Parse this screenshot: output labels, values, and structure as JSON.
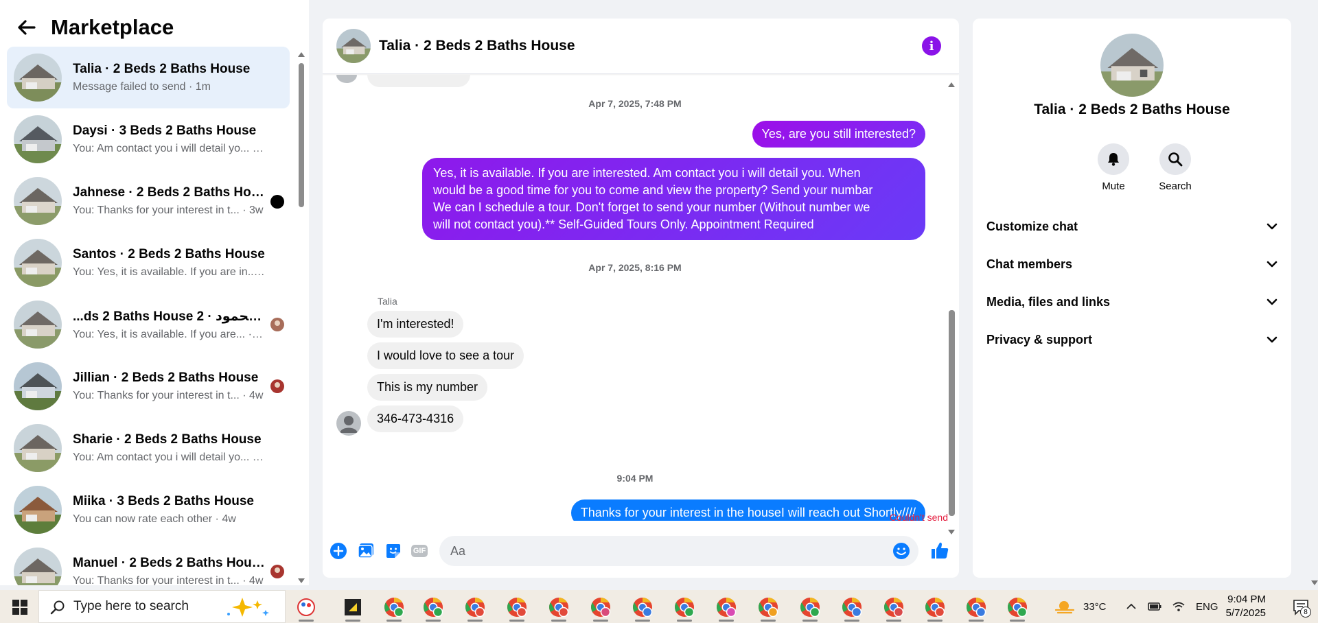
{
  "sidebar": {
    "title": "Marketplace",
    "conversations": [
      {
        "name": "Talia · 2 Beds 2 Baths House",
        "preview": "Message failed to send · 1m",
        "active": true,
        "indicator": "none"
      },
      {
        "name": "Daysi · 3 Beds 2 Baths House",
        "preview": "You: Am contact you i will detail yo... · 3w",
        "indicator": "none"
      },
      {
        "name": "Jahnese · 2 Beds 2 Baths House",
        "preview": "You: Thanks for your interest in t... · 3w",
        "indicator": "dot"
      },
      {
        "name": "Santos · 2 Beds 2 Baths House",
        "preview": "You: Yes, it is available. If you are in... · 3w",
        "indicator": "none"
      },
      {
        "name": "...ds 2 Baths House 2 · أبو محمود",
        "preview": "You: Yes, it is available. If you are... · 3w",
        "indicator": "mini"
      },
      {
        "name": "Jillian · 2 Beds 2 Baths House",
        "preview": "You: Thanks for your interest in t... · 4w",
        "indicator": "mini"
      },
      {
        "name": "Sharie · 2 Beds 2 Baths House",
        "preview": "You: Am contact you i will detail yo... · 4w",
        "indicator": "none"
      },
      {
        "name": "Miika · 3 Beds 2 Baths House",
        "preview": "You can now rate each other · 4w",
        "indicator": "none"
      },
      {
        "name": "Manuel · 2 Beds 2 Baths House",
        "preview": "You: Thanks for your interest in t... · 4w",
        "indicator": "mini"
      }
    ]
  },
  "chat": {
    "title": "Talia · 2 Beds 2 Baths House",
    "timestamp_1": "Apr 7, 2025, 7:48 PM",
    "out_msg_1": "Yes, are you still interested?",
    "out_msg_2_lines": [
      "Yes, it is available. If you are interested.  Am contact you i will detail you.  When",
      "would be a good time for you to come and view the property? Send your numbar",
      "We can I schedule a tour.  Don't forget to send your number (Without number we",
      "will not contact you).** Self-Guided Tours Only. Appointment Required"
    ],
    "timestamp_2": "Apr 7, 2025, 8:16 PM",
    "sender_name": "Talia",
    "in_msg_1": "I'm interested!",
    "in_msg_2": "I would love to see a tour",
    "in_msg_3": "This is my number",
    "in_msg_4": "346-473-4316",
    "timestamp_3": "9:04 PM",
    "out_msg_3": "Thanks for your interest in the houseI will reach out Shortly////",
    "send_error": "Couldn't send",
    "composer_placeholder": "Aa",
    "gif_label": "GIF"
  },
  "info_panel": {
    "title": "Talia · 2 Beds 2 Baths House",
    "mute_label": "Mute",
    "search_label": "Search",
    "sections": [
      "Customize chat",
      "Chat members",
      "Media, files and links",
      "Privacy & support"
    ]
  },
  "taskbar": {
    "search_placeholder": "Type here to search",
    "temperature": "33°C",
    "language": "ENG",
    "time": "9:04 PM",
    "date": "5/7/2025",
    "notification_count": "8"
  },
  "colors": {
    "messenger_purple": "#8a13e8",
    "messenger_blue": "#0a7cff",
    "error_red": "#e41e3f",
    "active_row": "#e7f0fb"
  }
}
